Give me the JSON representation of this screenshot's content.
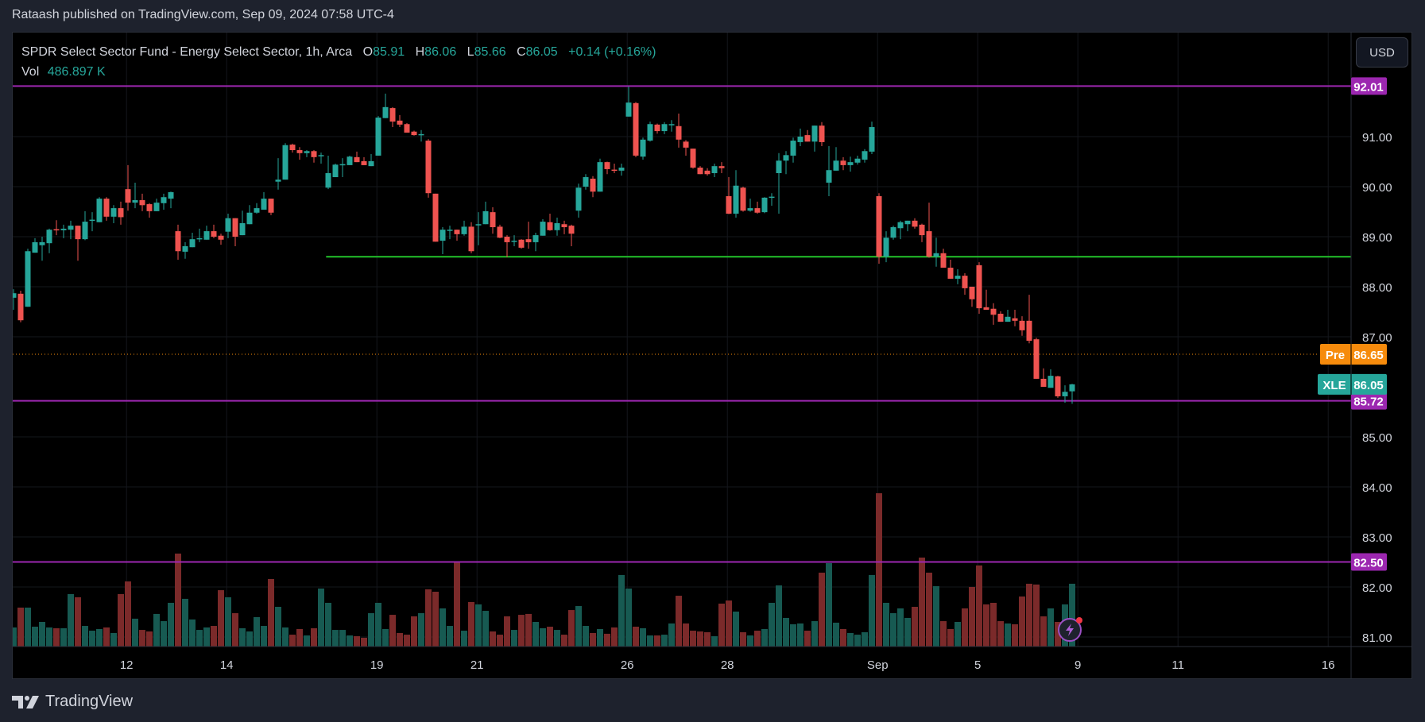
{
  "header": {
    "published": "Rataash published on TradingView.com, Sep 09, 2024 07:58 UTC-4"
  },
  "legend": {
    "title": "SPDR Select Sector Fund - Energy Select Sector, 1h, Arca",
    "o_label": "O",
    "o": "85.91",
    "h_label": "H",
    "h": "86.06",
    "l_label": "L",
    "l": "85.66",
    "c_label": "C",
    "c": "86.05",
    "change": "+0.14 (+0.16%)",
    "vol_label": "Vol",
    "vol": "486.897 K"
  },
  "axis": {
    "currency": "USD"
  },
  "footer": {
    "logo_text": "TradingView"
  },
  "colors": {
    "up": "#26a69a",
    "down": "#ef5350",
    "up_vol": "#175a52",
    "down_vol": "#7b2a2a",
    "level": "#9c27b0",
    "support": "#22c32a",
    "pre": "#f68b0c"
  },
  "icons": {
    "alert": "lightning-bolt-icon",
    "logo": "tradingview-logo-icon"
  },
  "chart_data": {
    "type": "candlestick",
    "symbol": "XLE",
    "interval": "1h",
    "ylim": [
      80.8,
      92.8
    ],
    "y_ticks": [
      "91.00",
      "90.00",
      "89.00",
      "88.00",
      "87.00",
      "85.00",
      "84.00",
      "83.00",
      "82.00",
      "81.00"
    ],
    "x_ticks": [
      {
        "label": "12",
        "bar": 16
      },
      {
        "label": "14",
        "bar": 30
      },
      {
        "label": "19",
        "bar": 51
      },
      {
        "label": "21",
        "bar": 65
      },
      {
        "label": "26",
        "bar": 86
      },
      {
        "label": "28",
        "bar": 100
      },
      {
        "label": "Sep",
        "bar": 121
      },
      {
        "label": "5",
        "bar": 135
      },
      {
        "label": "9",
        "bar": 149
      },
      {
        "label": "11",
        "bar": 163
      },
      {
        "label": "16",
        "bar": 184
      }
    ],
    "levels": [
      {
        "price": 92.01,
        "label": "92.01",
        "kind": "level"
      },
      {
        "price": 88.6,
        "label": "",
        "kind": "support",
        "start_bar": 43.7
      },
      {
        "price": 85.72,
        "label": "85.72",
        "kind": "level"
      },
      {
        "price": 82.5,
        "label": "82.50",
        "kind": "level"
      }
    ],
    "premarket": {
      "tag": "Pre",
      "price": 86.65,
      "label": "86.65"
    },
    "last": {
      "tag": "XLE",
      "price": 86.05,
      "label": "86.05"
    },
    "candles_ohlc": [
      [
        87.78,
        87.95,
        87.54,
        87.87
      ],
      [
        87.86,
        87.92,
        87.29,
        87.33
      ],
      [
        87.6,
        88.76,
        87.6,
        88.71
      ],
      [
        88.68,
        88.97,
        88.68,
        88.89
      ],
      [
        88.83,
        89.0,
        88.52,
        88.89
      ],
      [
        88.87,
        89.16,
        88.67,
        89.14
      ],
      [
        89.15,
        89.33,
        89.03,
        89.13
      ],
      [
        89.13,
        89.24,
        88.97,
        89.16
      ],
      [
        89.14,
        89.32,
        88.95,
        89.22
      ],
      [
        89.22,
        89.22,
        88.52,
        88.95
      ],
      [
        88.95,
        89.51,
        88.93,
        89.3
      ],
      [
        89.32,
        89.49,
        89.11,
        89.34
      ],
      [
        89.29,
        89.79,
        89.29,
        89.76
      ],
      [
        89.76,
        89.79,
        89.32,
        89.4
      ],
      [
        89.4,
        89.63,
        89.27,
        89.57
      ],
      [
        89.57,
        89.7,
        89.24,
        89.39
      ],
      [
        89.95,
        90.43,
        89.52,
        89.68
      ],
      [
        89.68,
        90.08,
        89.57,
        89.73
      ],
      [
        89.73,
        89.86,
        89.51,
        89.63
      ],
      [
        89.65,
        89.67,
        89.38,
        89.51
      ],
      [
        89.51,
        89.76,
        89.51,
        89.68
      ],
      [
        89.67,
        89.86,
        89.54,
        89.79
      ],
      [
        89.76,
        89.9,
        89.57,
        89.89
      ],
      [
        89.11,
        89.24,
        88.54,
        88.71
      ],
      [
        88.7,
        88.89,
        88.56,
        88.81
      ],
      [
        88.79,
        89.08,
        88.79,
        88.95
      ],
      [
        88.96,
        89.16,
        88.89,
        88.97
      ],
      [
        88.94,
        89.22,
        88.94,
        89.11
      ],
      [
        89.11,
        89.24,
        88.97,
        89.0
      ],
      [
        89.02,
        89.06,
        88.84,
        88.94
      ],
      [
        89.1,
        89.46,
        88.97,
        89.37
      ],
      [
        89.37,
        89.37,
        88.81,
        89.0
      ],
      [
        89.03,
        89.52,
        89.03,
        89.27
      ],
      [
        89.25,
        89.63,
        89.25,
        89.48
      ],
      [
        89.48,
        89.67,
        89.46,
        89.57
      ],
      [
        89.54,
        89.89,
        89.54,
        89.76
      ],
      [
        89.76,
        89.76,
        89.43,
        89.48
      ],
      [
        90.1,
        90.57,
        89.94,
        90.14
      ],
      [
        90.14,
        90.87,
        90.14,
        90.83
      ],
      [
        90.84,
        90.86,
        90.68,
        90.73
      ],
      [
        90.73,
        90.79,
        90.54,
        90.67
      ],
      [
        90.67,
        90.73,
        90.59,
        90.71
      ],
      [
        90.71,
        90.73,
        90.48,
        90.59
      ],
      [
        90.61,
        90.68,
        90.46,
        90.63
      ],
      [
        89.98,
        90.62,
        89.95,
        90.27
      ],
      [
        90.19,
        90.46,
        90.19,
        90.44
      ],
      [
        90.43,
        90.57,
        90.19,
        90.45
      ],
      [
        90.43,
        90.62,
        90.43,
        90.6
      ],
      [
        90.59,
        90.7,
        90.49,
        90.49
      ],
      [
        90.51,
        90.59,
        90.43,
        90.43
      ],
      [
        90.41,
        90.65,
        90.41,
        90.51
      ],
      [
        90.62,
        91.41,
        90.62,
        91.38
      ],
      [
        91.37,
        91.86,
        91.37,
        91.59
      ],
      [
        91.57,
        91.59,
        91.19,
        91.3
      ],
      [
        91.32,
        91.43,
        91.19,
        91.24
      ],
      [
        91.25,
        91.27,
        91.08,
        91.08
      ],
      [
        91.1,
        91.12,
        91.02,
        91.03
      ],
      [
        91.04,
        91.13,
        90.9,
        91.05
      ],
      [
        90.92,
        90.95,
        89.78,
        89.87
      ],
      [
        89.86,
        89.86,
        88.9,
        88.9
      ],
      [
        88.92,
        89.19,
        88.65,
        89.14
      ],
      [
        89.13,
        89.22,
        88.95,
        89.14
      ],
      [
        89.14,
        89.14,
        88.92,
        89.05
      ],
      [
        89.05,
        89.32,
        89.02,
        89.2
      ],
      [
        89.2,
        89.29,
        88.67,
        88.71
      ],
      [
        89.24,
        89.49,
        88.83,
        89.25
      ],
      [
        89.25,
        89.7,
        89.25,
        89.51
      ],
      [
        89.49,
        89.59,
        89.06,
        89.19
      ],
      [
        89.2,
        89.24,
        88.97,
        88.98
      ],
      [
        89.0,
        89.03,
        88.59,
        88.89
      ],
      [
        88.91,
        89.03,
        88.81,
        88.92
      ],
      [
        88.94,
        88.95,
        88.76,
        88.78
      ],
      [
        88.95,
        89.3,
        88.76,
        88.89
      ],
      [
        88.89,
        89.08,
        88.71,
        89.03
      ],
      [
        89.02,
        89.35,
        89.02,
        89.3
      ],
      [
        89.29,
        89.46,
        89.12,
        89.13
      ],
      [
        89.13,
        89.38,
        89.02,
        89.27
      ],
      [
        89.25,
        89.32,
        89.05,
        89.19
      ],
      [
        89.22,
        89.24,
        88.81,
        89.06
      ],
      [
        89.52,
        90.06,
        89.38,
        89.98
      ],
      [
        90.0,
        90.25,
        89.94,
        90.19
      ],
      [
        90.16,
        90.21,
        89.79,
        89.9
      ],
      [
        89.9,
        90.56,
        89.9,
        90.49
      ],
      [
        90.49,
        90.5,
        90.25,
        90.35
      ],
      [
        90.34,
        90.46,
        90.27,
        90.32
      ],
      [
        90.32,
        90.46,
        90.22,
        90.38
      ],
      [
        91.4,
        92.0,
        91.4,
        91.68
      ],
      [
        91.67,
        91.69,
        90.59,
        90.62
      ],
      [
        90.6,
        90.98,
        90.54,
        90.94
      ],
      [
        90.92,
        91.3,
        90.9,
        91.25
      ],
      [
        91.24,
        91.26,
        91.06,
        91.11
      ],
      [
        91.11,
        91.29,
        91.05,
        91.25
      ],
      [
        91.23,
        91.33,
        91.1,
        91.25
      ],
      [
        91.21,
        91.46,
        90.78,
        90.94
      ],
      [
        90.9,
        90.93,
        90.62,
        90.78
      ],
      [
        90.76,
        90.76,
        90.36,
        90.38
      ],
      [
        90.38,
        90.41,
        90.25,
        90.25
      ],
      [
        90.32,
        90.37,
        90.22,
        90.25
      ],
      [
        90.27,
        90.46,
        90.19,
        90.41
      ],
      [
        90.41,
        90.49,
        90.27,
        90.37
      ],
      [
        89.81,
        90.19,
        89.45,
        89.46
      ],
      [
        89.46,
        90.33,
        89.38,
        90.02
      ],
      [
        89.98,
        90.0,
        89.5,
        89.52
      ],
      [
        89.52,
        89.76,
        89.5,
        89.57
      ],
      [
        89.57,
        89.7,
        89.46,
        89.48
      ],
      [
        89.49,
        89.79,
        89.47,
        89.78
      ],
      [
        89.78,
        89.87,
        89.62,
        89.8
      ],
      [
        90.27,
        90.67,
        89.46,
        90.52
      ],
      [
        90.52,
        90.71,
        90.25,
        90.63
      ],
      [
        90.62,
        90.98,
        90.48,
        90.92
      ],
      [
        90.89,
        91.16,
        90.81,
        91.0
      ],
      [
        91.03,
        91.13,
        90.9,
        90.9
      ],
      [
        90.9,
        91.22,
        90.7,
        91.22
      ],
      [
        91.22,
        91.29,
        90.81,
        90.89
      ],
      [
        90.08,
        90.81,
        89.81,
        90.33
      ],
      [
        90.32,
        90.79,
        90.32,
        90.52
      ],
      [
        90.52,
        90.59,
        90.33,
        90.43
      ],
      [
        90.43,
        90.6,
        90.3,
        90.49
      ],
      [
        90.48,
        90.62,
        90.44,
        90.56
      ],
      [
        90.54,
        90.75,
        90.48,
        90.71
      ],
      [
        90.7,
        91.3,
        90.65,
        91.19
      ],
      [
        89.81,
        89.87,
        88.46,
        88.6
      ],
      [
        88.6,
        89.11,
        88.49,
        88.98
      ],
      [
        88.98,
        89.22,
        88.94,
        89.19
      ],
      [
        89.17,
        89.32,
        88.95,
        89.29
      ],
      [
        89.25,
        89.32,
        89.11,
        89.32
      ],
      [
        89.32,
        89.37,
        89.16,
        89.2
      ],
      [
        89.24,
        89.26,
        88.89,
        89.03
      ],
      [
        89.11,
        89.68,
        88.58,
        88.6
      ],
      [
        88.6,
        88.98,
        88.4,
        88.67
      ],
      [
        88.67,
        88.76,
        88.38,
        88.38
      ],
      [
        88.38,
        88.54,
        88.16,
        88.16
      ],
      [
        88.16,
        88.35,
        88.05,
        88.22
      ],
      [
        88.22,
        88.27,
        87.84,
        87.97
      ],
      [
        88.0,
        88.0,
        87.6,
        87.75
      ],
      [
        88.43,
        88.49,
        87.46,
        87.57
      ],
      [
        87.59,
        87.94,
        87.54,
        87.54
      ],
      [
        87.56,
        87.67,
        87.24,
        87.44
      ],
      [
        87.46,
        87.51,
        87.3,
        87.3
      ],
      [
        87.3,
        87.54,
        87.3,
        87.4
      ],
      [
        87.37,
        87.54,
        87.21,
        87.32
      ],
      [
        87.32,
        87.41,
        87.02,
        87.13
      ],
      [
        87.32,
        87.84,
        86.87,
        86.92
      ],
      [
        86.95,
        86.98,
        86.16,
        86.16
      ],
      [
        86.16,
        86.37,
        86.0,
        86.0
      ],
      [
        85.98,
        86.35,
        85.98,
        86.22
      ],
      [
        86.21,
        86.22,
        85.78,
        85.81
      ],
      [
        85.81,
        86.03,
        85.68,
        85.9
      ],
      [
        85.91,
        86.06,
        85.66,
        86.05
      ]
    ],
    "volume_k": [
      148,
      302,
      302,
      154,
      191,
      148,
      142,
      142,
      407,
      382,
      160,
      123,
      136,
      148,
      105,
      407,
      505,
      216,
      129,
      117,
      253,
      197,
      339,
      721,
      370,
      210,
      129,
      148,
      160,
      437,
      382,
      259,
      142,
      117,
      228,
      160,
      524,
      308,
      148,
      92,
      136,
      86,
      142,
      450,
      339,
      129,
      129,
      86,
      80,
      68,
      259,
      339,
      136,
      246,
      105,
      92,
      234,
      259,
      444,
      425,
      296,
      160,
      653,
      123,
      345,
      327,
      277,
      117,
      92,
      234,
      129,
      246,
      253,
      191,
      142,
      154,
      129,
      92,
      283,
      314,
      160,
      105,
      136,
      99,
      148,
      555,
      450,
      154,
      142,
      86,
      86,
      92,
      179,
      394,
      179,
      123,
      117,
      111,
      80,
      333,
      357,
      271,
      111,
      86,
      123,
      136,
      339,
      474,
      222,
      173,
      179,
      123,
      197,
      573,
      647,
      185,
      136,
      105,
      92,
      111,
      555,
      1189,
      339,
      259,
      296,
      222,
      308,
      690,
      573,
      468,
      197,
      136,
      191,
      296,
      462,
      629,
      327,
      339,
      197,
      179,
      173,
      388,
      487,
      481,
      234,
      296,
      191,
      327,
      487
    ]
  }
}
